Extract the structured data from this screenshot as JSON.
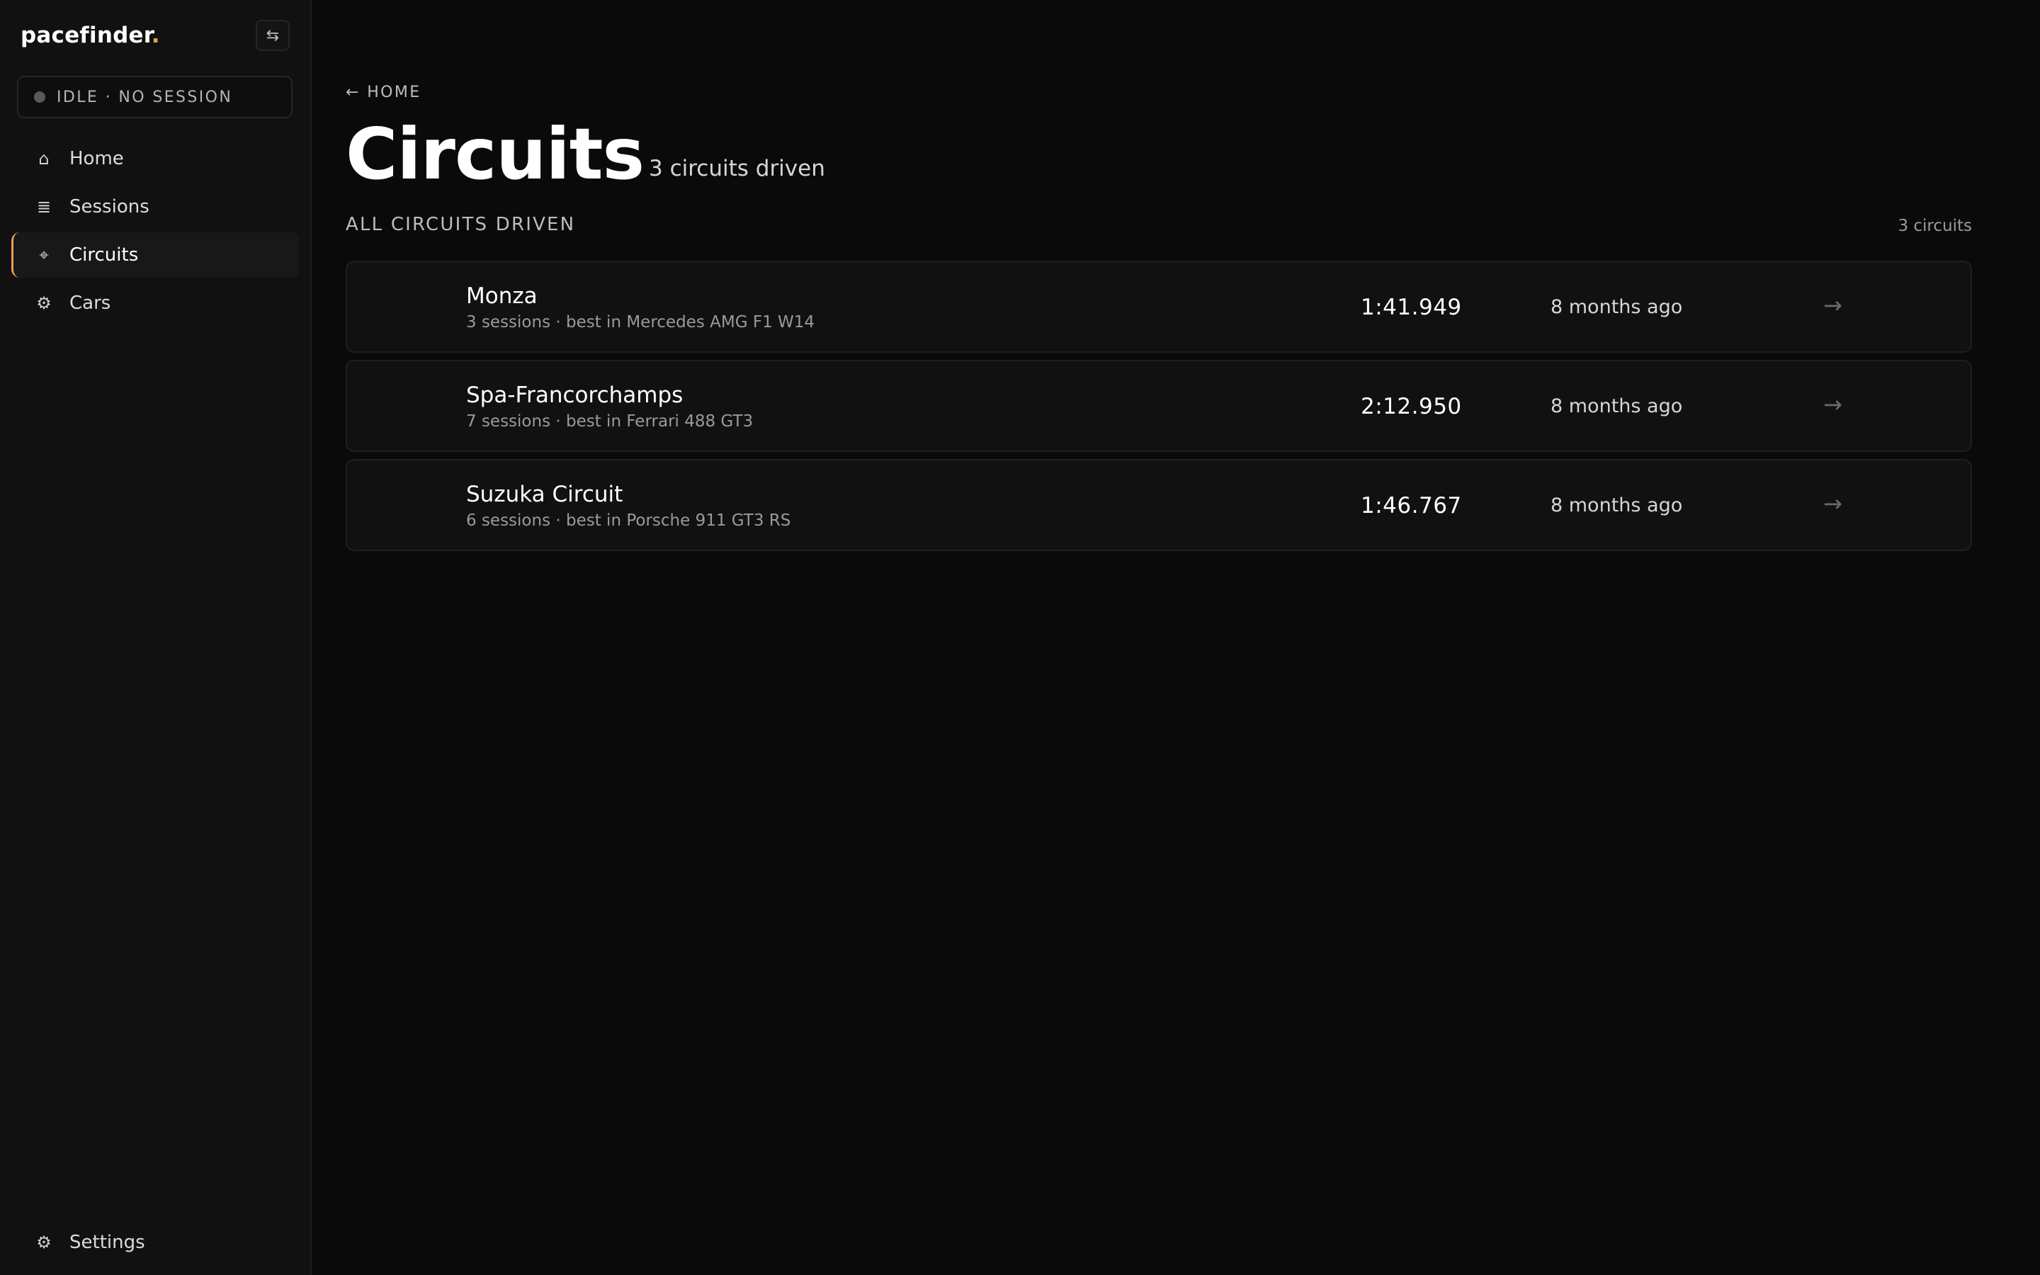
{
  "brand": {
    "name": "pacefinder",
    "accent": "."
  },
  "colors": {
    "accent": "#e8a050",
    "background": "#0a0a0a",
    "sidebar": "#111111"
  },
  "collapse_icon": "⇆",
  "status": {
    "text": "IDLE · NO SESSION"
  },
  "nav": [
    {
      "icon": "⌂",
      "label": "Home"
    },
    {
      "icon": "≣",
      "label": "Sessions"
    },
    {
      "icon": "⌖",
      "label": "Circuits"
    },
    {
      "icon": "⚙",
      "label": "Cars"
    }
  ],
  "settings": {
    "icon": "⚙",
    "label": "Settings"
  },
  "header": {
    "back": "← HOME",
    "title": "Circuits",
    "subtitle": "3 circuits driven"
  },
  "section": {
    "label": "ALL CIRCUITS DRIVEN",
    "count": "3 circuits"
  },
  "circuits": [
    {
      "name": "Monza",
      "meta": "3 sessions · best in Mercedes AMG F1 W14",
      "best": "1:41.949",
      "ago": "8 months ago",
      "arrow": "→"
    },
    {
      "name": "Spa-Francorchamps",
      "meta": "7 sessions · best in Ferrari 488 GT3",
      "best": "2:12.950",
      "ago": "8 months ago",
      "arrow": "→"
    },
    {
      "name": "Suzuka Circuit",
      "meta": "6 sessions · best in Porsche 911 GT3 RS",
      "best": "1:46.767",
      "ago": "8 months ago",
      "arrow": "→"
    }
  ]
}
